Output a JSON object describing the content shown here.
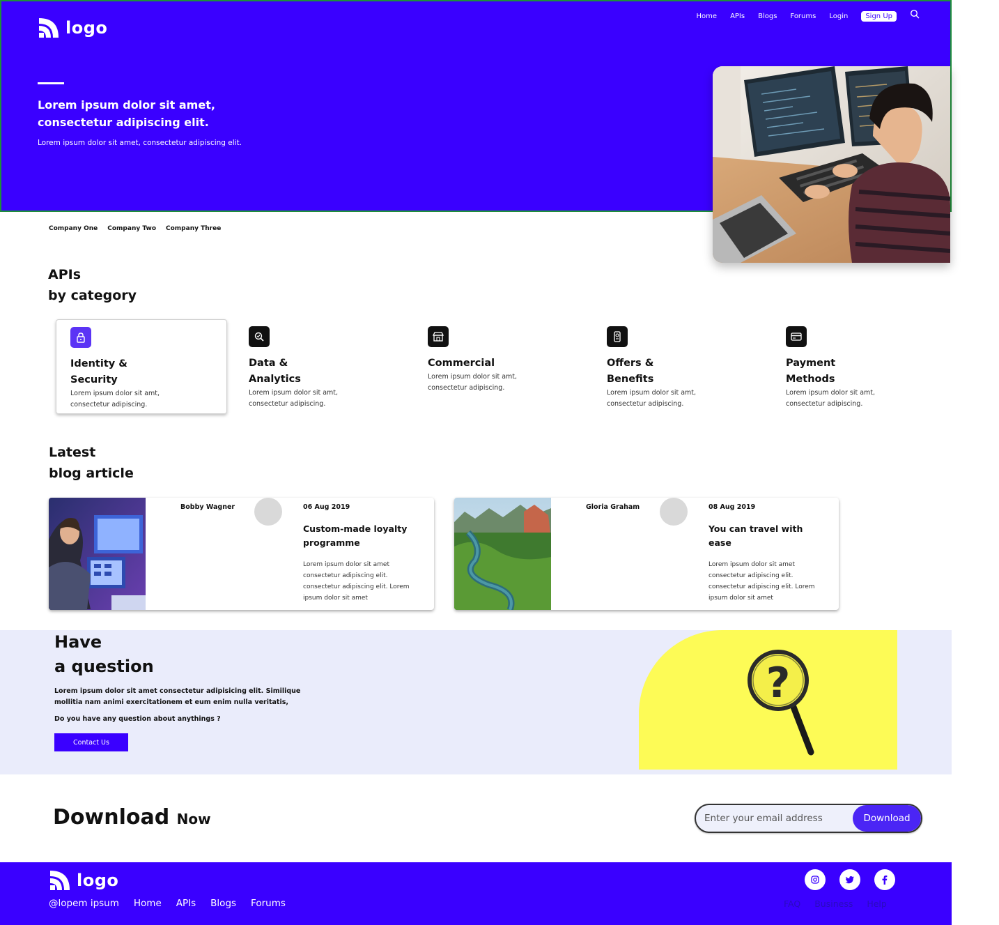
{
  "hero": {
    "logo_text": "logo",
    "nav": [
      "Home",
      "APIs",
      "Blogs",
      "Forums",
      "Login"
    ],
    "signup_label": "Sign Up",
    "title": "Lorem ipsum dolor sit amet, consectetur adipiscing elit.",
    "subtitle": "Lorem ipsum dolor sit amet, consectetur adipiscing elit."
  },
  "companies": [
    "Company One",
    "Company Two",
    "Company Three"
  ],
  "apis_section": {
    "title_line1": "APIs",
    "title_line2": "by category",
    "categories": [
      {
        "title": "Identity & Security",
        "desc": "Lorem ipsum dolor sit amt, consectetur adipiscing.",
        "icon": "lock-icon"
      },
      {
        "title": "Data & Analytics",
        "desc": "Lorem ipsum dolor sit amt, consectetur adipiscing.",
        "icon": "analytics-icon"
      },
      {
        "title": "Commercial",
        "desc": "Lorem ipsum dolor sit amt, consectetur adipiscing.",
        "icon": "store-icon"
      },
      {
        "title": "Offers & Benefits",
        "desc": "Lorem ipsum dolor sit amt, consectetur adipiscing.",
        "icon": "offers-icon"
      },
      {
        "title": "Payment Methods",
        "desc": "Lorem ipsum dolor sit amt, consectetur adipiscing.",
        "icon": "card-icon"
      }
    ]
  },
  "blog_section": {
    "title_line1": "Latest",
    "title_line2": "blog article",
    "posts": [
      {
        "author": "Bobby Wagner",
        "date": "06 Aug 2019",
        "title": "Custom-made loyalty programme",
        "body": "Lorem ipsum dolor sit amet consectetur adipiscing elit. consectetur adipiscing elit. Lorem ipsum dolor sit amet"
      },
      {
        "author": "Gloria Graham",
        "date": "08 Aug 2019",
        "title": "You can travel with ease",
        "body": "Lorem ipsum dolor sit amet consectetur adipiscing elit. consectetur adipiscing elit. Lorem ipsum dolor sit amet"
      }
    ]
  },
  "question": {
    "title_line1": "Have",
    "title_line2": "a question",
    "text": "Lorem ipsum dolor sit amet consectetur adipisicing elit. Similique mollitia nam animi exercitationem et eum enim nulla veritatis,",
    "prompt": "Do you have any question about anythings ?",
    "button": "Contact Us"
  },
  "download": {
    "title": "Download",
    "title_small": "Now",
    "placeholder": "Enter your email address",
    "button": "Download"
  },
  "footer": {
    "logo_text": "logo",
    "links": [
      "@lopem ipsum",
      "Home",
      "APIs",
      "Blogs",
      "Forums"
    ],
    "right_links": [
      "FAQ",
      "Business",
      "Help"
    ]
  },
  "colors": {
    "brand": "#3a00ff",
    "accent": "#5b34f5",
    "question_bg": "#eaecfb",
    "yellow": "#fdfb56"
  }
}
